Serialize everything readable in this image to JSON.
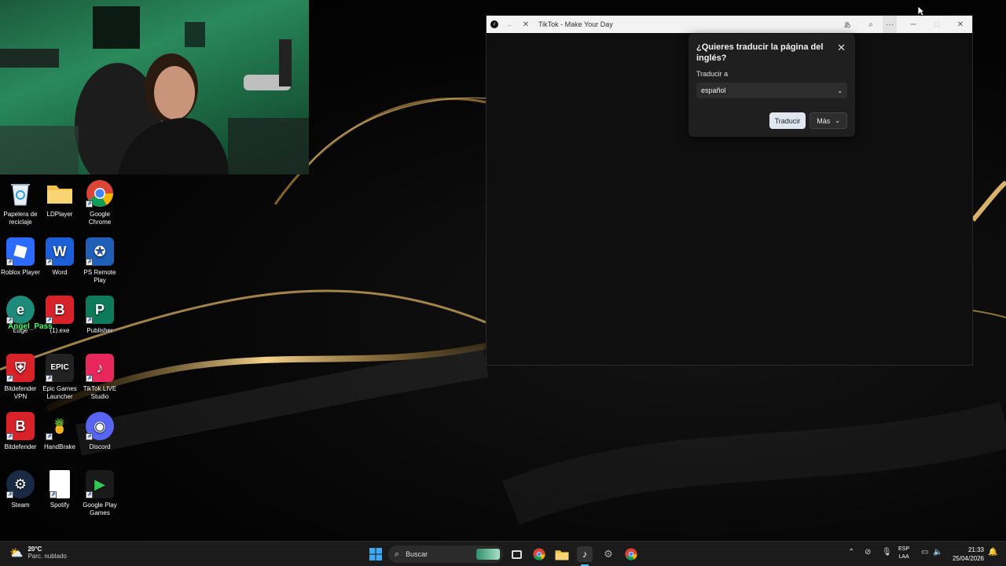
{
  "desktop": {
    "icons": [
      {
        "label": "Papelera de reciclaje",
        "color": "#3a3a3a",
        "glyph": "♻"
      },
      {
        "label": "LDPlayer",
        "color": "#e9b949",
        "glyph": ""
      },
      {
        "label": "Google Chrome",
        "color": "#ffffff",
        "glyph": ""
      },
      {
        "label": "Roblox Player",
        "color": "#2b6bff",
        "glyph": "■"
      },
      {
        "label": "Word",
        "color": "#1d5fd6",
        "glyph": "W"
      },
      {
        "label": "PS Remote Play",
        "color": "#1f5fb8",
        "glyph": "✪"
      },
      {
        "label": "Edge",
        "color": "#1d8a7a",
        "glyph": "e"
      },
      {
        "label": "(1).exe",
        "color": "#d8222a",
        "glyph": "B"
      },
      {
        "label": "Publisher",
        "color": "#0c7a5b",
        "glyph": "P"
      },
      {
        "label": "Bitdefender VPN",
        "color": "#d8222a",
        "glyph": "⛨"
      },
      {
        "label": "Epic Games Launcher",
        "color": "#222222",
        "glyph": "EPIC"
      },
      {
        "label": "TikTok LIVE Studio",
        "color": "#e8285c",
        "glyph": "♪"
      },
      {
        "label": "Bitdefender",
        "color": "#d8222a",
        "glyph": "B"
      },
      {
        "label": "HandBrake",
        "color": "#3a2a1a",
        "glyph": "🍍"
      },
      {
        "label": "Discord",
        "color": "#5865f2",
        "glyph": "◉"
      },
      {
        "label": "Steam",
        "color": "#1a2a44",
        "glyph": "⚙"
      },
      {
        "label": "Spotify",
        "color": "#ffffff",
        "glyph": ""
      },
      {
        "label": "Google Play Games",
        "color": "#1a1a1a",
        "glyph": "▶"
      }
    ],
    "overlay_text": "Angel_Pass"
  },
  "browser": {
    "title": "TikTok - Make Your Day"
  },
  "translate_popup": {
    "question": "¿Quieres traducir la página del inglés?",
    "target_label": "Traducir a",
    "selected_language": "español",
    "translate_button": "Traducir",
    "more_button": "Más"
  },
  "taskbar": {
    "temperature": "20°C",
    "weather_desc": "Parc. nublado",
    "search_placeholder": "Buscar",
    "lang_line1": "ESP",
    "lang_line2": "LAA",
    "time": "21:33",
    "date": "25/04/2026"
  }
}
